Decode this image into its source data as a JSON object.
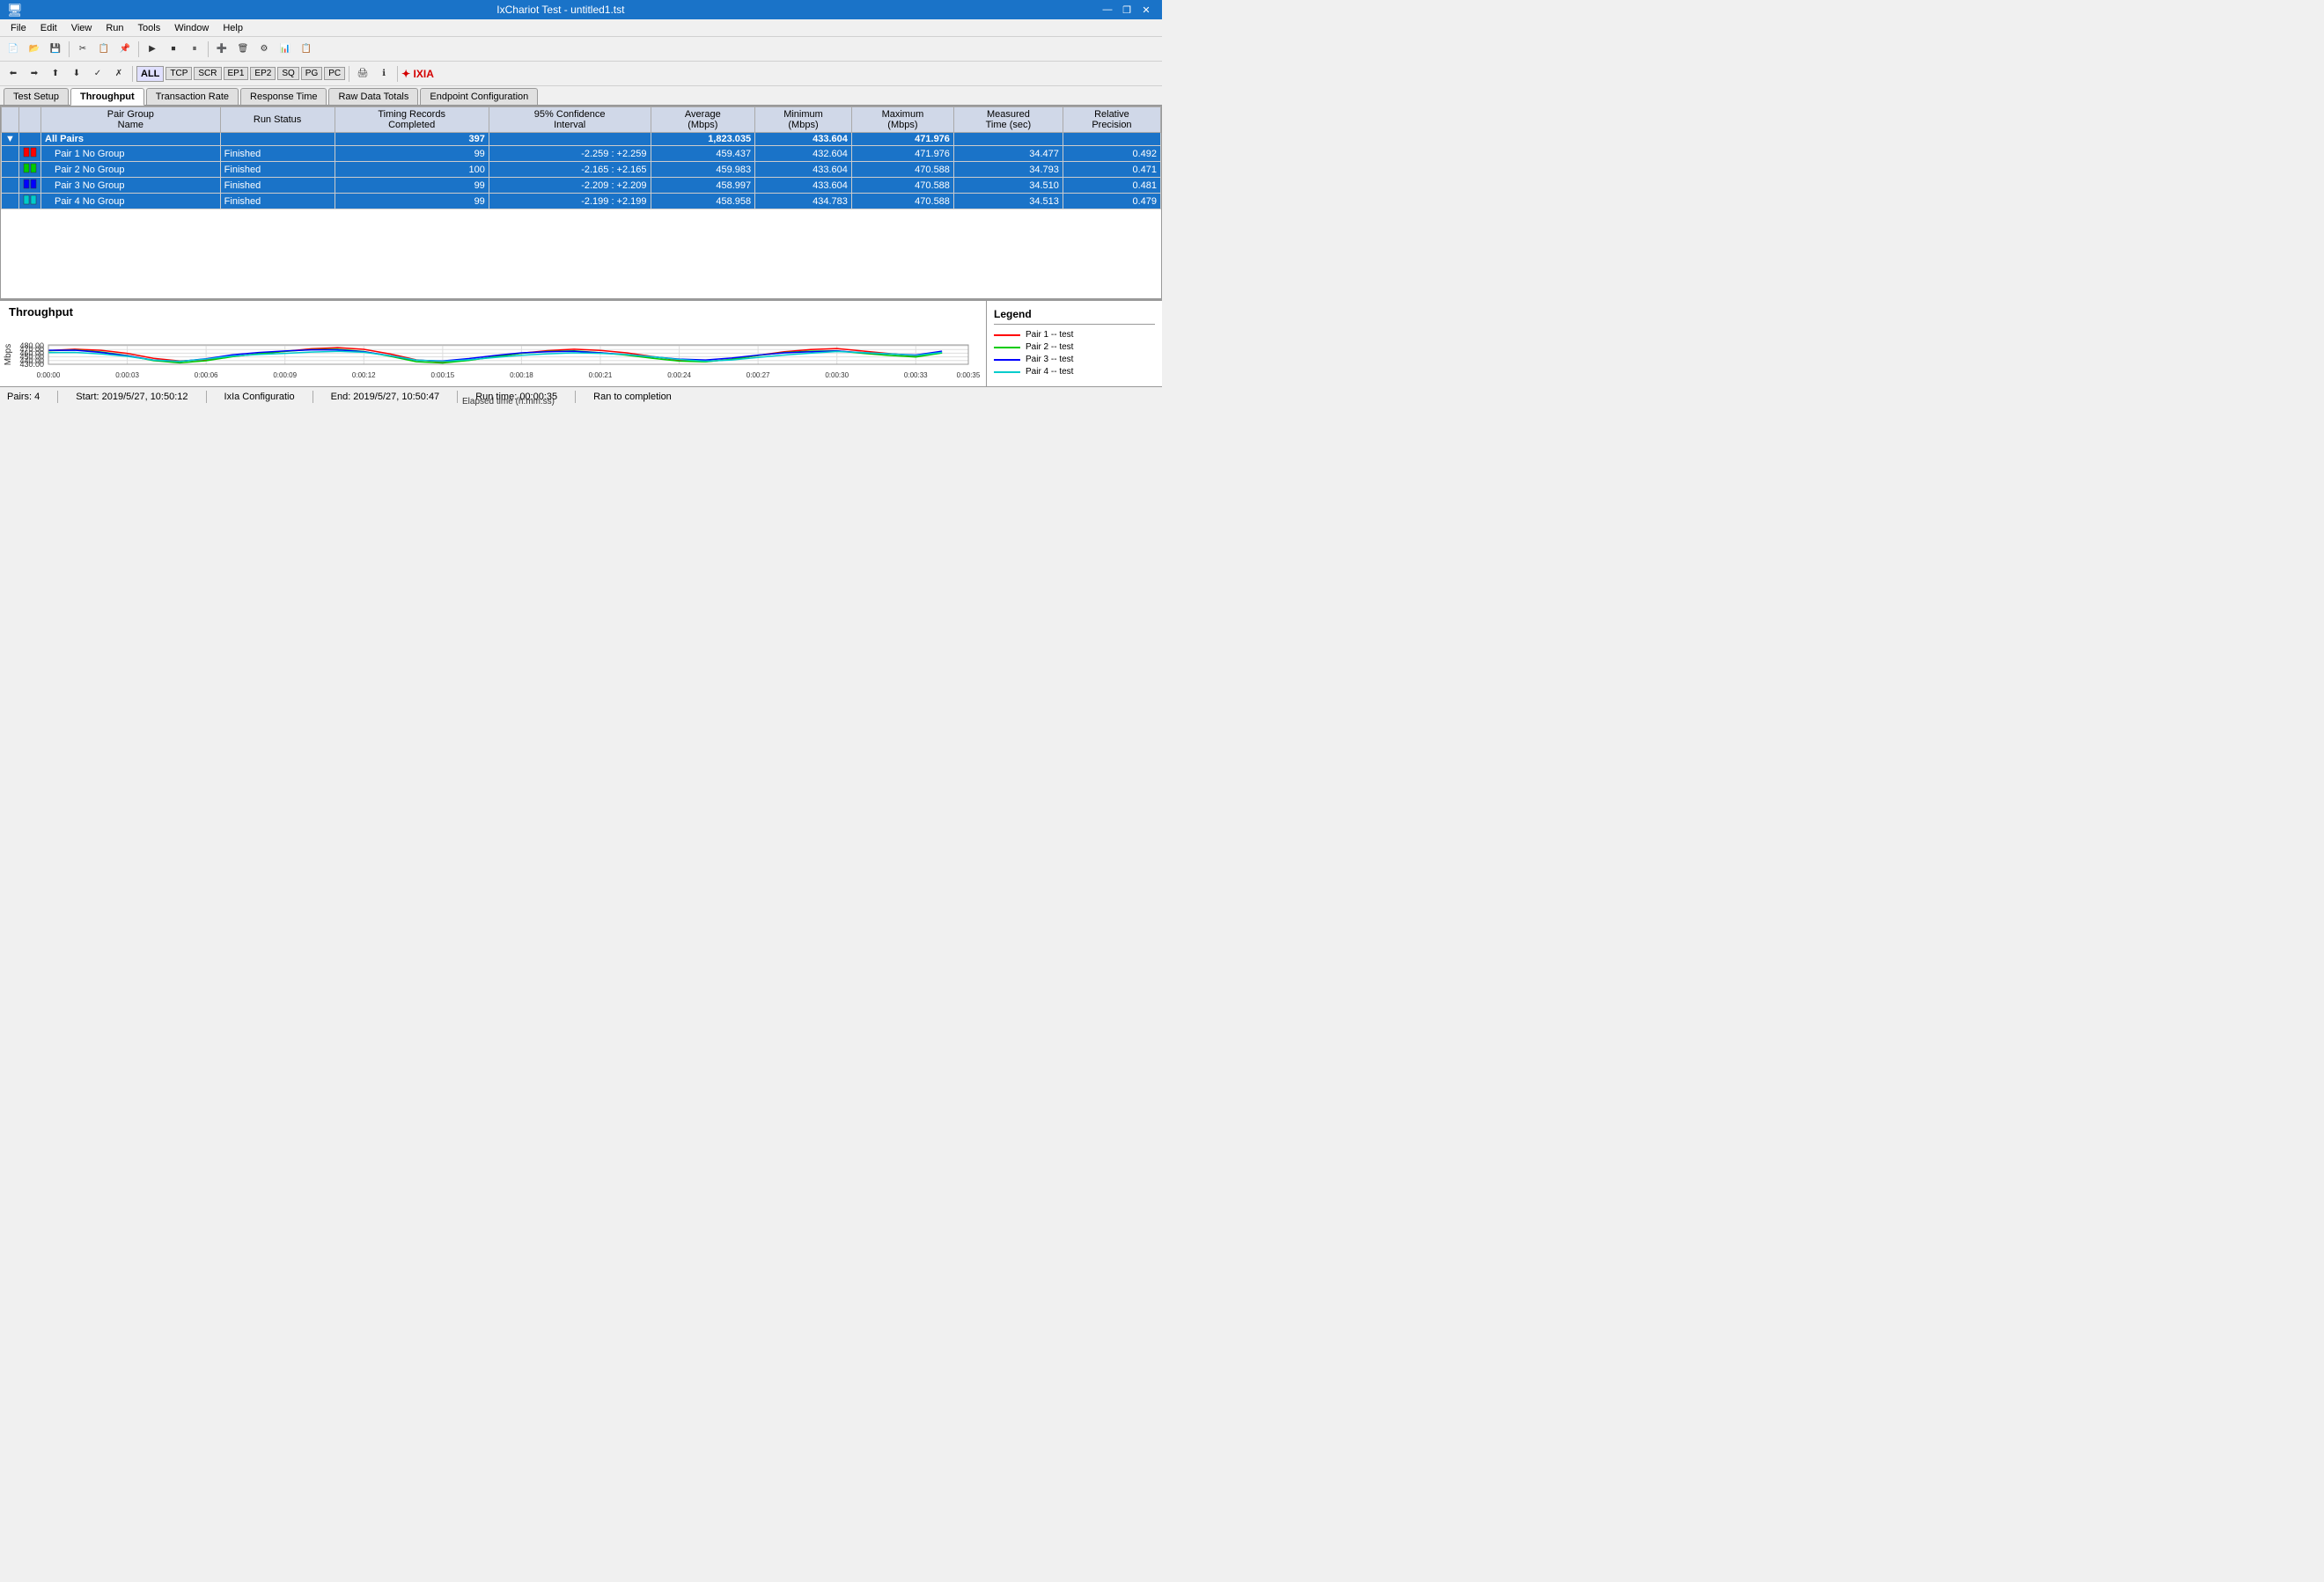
{
  "titlebar": {
    "title": "IxChariot Test - untitled1.tst",
    "min_label": "—",
    "restore_label": "❐",
    "close_label": "✕"
  },
  "menubar": {
    "items": [
      "File",
      "Edit",
      "View",
      "Run",
      "Tools",
      "Window",
      "Help"
    ]
  },
  "toolbar1": {
    "buttons": [
      "📄",
      "📂",
      "💾",
      "✂",
      "📋",
      "↩",
      "↪",
      "▶",
      "⏹",
      "⏸"
    ]
  },
  "toolbar2": {
    "all_label": "ALL",
    "protocols": [
      "TCP",
      "SCR",
      "EP1",
      "EP2",
      "SQ",
      "PG",
      "PC"
    ],
    "info_icon": "ℹ",
    "ixia_label": "IXIA"
  },
  "tabs": {
    "items": [
      "Test Setup",
      "Throughput",
      "Transaction Rate",
      "Response Time",
      "Raw Data Totals",
      "Endpoint Configuration"
    ]
  },
  "table": {
    "headers": [
      "",
      "Pair Group Name",
      "Run Status",
      "Timing Records Completed",
      "95% Confidence Interval",
      "Average (Mbps)",
      "Minimum (Mbps)",
      "Maximum (Mbps)",
      "Measured Time (sec)",
      "Relative Precision"
    ],
    "rows": [
      {
        "type": "all",
        "group": "All Pairs",
        "run_status": "",
        "timing": "397",
        "confidence": "",
        "average": "1,823.035",
        "minimum": "433.604",
        "maximum": "471.976",
        "measured": "",
        "relative": ""
      },
      {
        "type": "pair",
        "group": "Pair 1 No Group",
        "run_status": "Finished",
        "timing": "99",
        "confidence": "-2.259 : +2.259",
        "average": "459.437",
        "minimum": "432.604",
        "maximum": "471.976",
        "measured": "34.477",
        "relative": "0.492"
      },
      {
        "type": "pair",
        "group": "Pair 2 No Group",
        "run_status": "Finished",
        "timing": "100",
        "confidence": "-2.165 : +2.165",
        "average": "459.983",
        "minimum": "433.604",
        "maximum": "470.588",
        "measured": "34.793",
        "relative": "0.471"
      },
      {
        "type": "pair",
        "group": "Pair 3 No Group",
        "run_status": "Finished",
        "timing": "99",
        "confidence": "-2.209 : +2.209",
        "average": "458.997",
        "minimum": "433.604",
        "maximum": "470.588",
        "measured": "34.510",
        "relative": "0.481"
      },
      {
        "type": "pair",
        "group": "Pair 4 No Group",
        "run_status": "Finished",
        "timing": "99",
        "confidence": "-2.199 : +2.199",
        "average": "458.958",
        "minimum": "434.783",
        "maximum": "470.588",
        "measured": "34.513",
        "relative": "0.479"
      }
    ]
  },
  "chart": {
    "title": "Throughput",
    "y_axis_label": "Mbps",
    "x_axis_label": "Elapsed time (h:mm:ss)",
    "y_min": 430,
    "y_max": 482.5,
    "y_ticks": [
      430,
      440,
      450,
      460,
      470,
      480
    ],
    "y_tick_labels": [
      "430.00",
      "440.00",
      "450.00",
      "460.00",
      "470.00",
      "480.00"
    ],
    "x_ticks": [
      "0:00:00",
      "0:00:03",
      "0:00:06",
      "0:00:09",
      "0:00:12",
      "0:00:15",
      "0:00:18",
      "0:00:21",
      "0:00:24",
      "0:00:27",
      "0:00:30",
      "0:00:33",
      "0:00:35"
    ]
  },
  "legend": {
    "title": "Legend",
    "items": [
      {
        "label": "Pair 1 -- test",
        "color": "#ff0000"
      },
      {
        "label": "Pair 2 -- test",
        "color": "#00cc00"
      },
      {
        "label": "Pair 3 -- test",
        "color": "#0000ff"
      },
      {
        "label": "Pair 4 -- test",
        "color": "#00cccc"
      }
    ]
  },
  "statusbar": {
    "pairs": "Pairs: 4",
    "start": "Start: 2019/5/27, 10:50:12",
    "config": "IxIa Configuratio",
    "end": "End: 2019/5/27, 10:50:47",
    "runtime": "Run time: 00:00:35",
    "status": "Ran to completion"
  }
}
